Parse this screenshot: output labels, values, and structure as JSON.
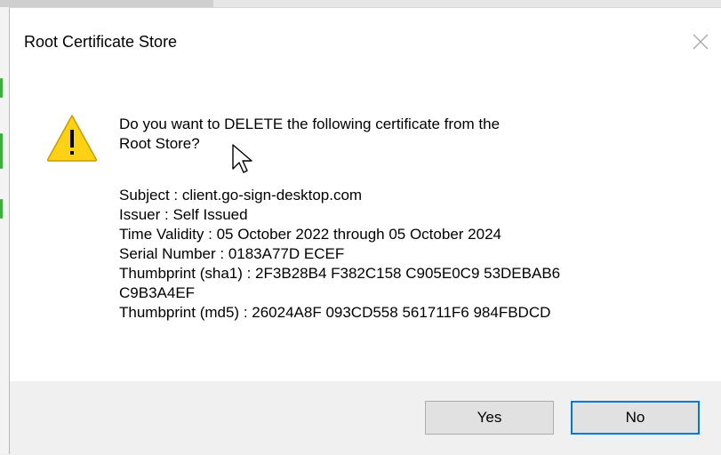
{
  "dialog": {
    "title": "Root Certificate Store",
    "message_line1": "Do you want to DELETE the following certificate from the",
    "message_line2": "Root Store?",
    "details": {
      "subject": "Subject : client.go-sign-desktop.com",
      "issuer": "Issuer : Self Issued",
      "validity": "Time Validity : 05 October 2022 through 05 October 2024",
      "serial": "Serial Number : 0183A77D ECEF",
      "sha1_line1": "Thumbprint (sha1) : 2F3B28B4 F382C158 C905E0C9 53DEBAB6",
      "sha1_line2": "C9B3A4EF",
      "md5": "Thumbprint (md5) : 26024A8F 093CD558 561711F6 984FBDCD"
    },
    "buttons": {
      "yes_label": "Yes",
      "no_label": "No"
    }
  },
  "icons": {
    "warning": "warning-icon",
    "close": "close-icon",
    "cursor": "mouse-cursor-icon"
  },
  "colors": {
    "warning_fill": "#fcd116",
    "warning_outline": "#c89b00",
    "focus_border": "#0078d7",
    "button_bar": "#f0f0f0"
  }
}
